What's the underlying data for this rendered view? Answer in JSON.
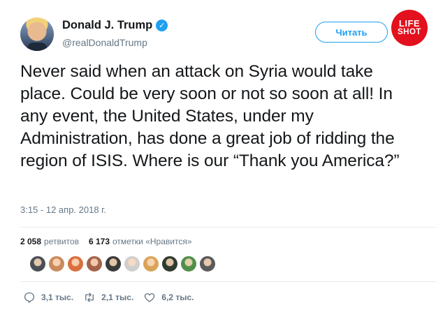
{
  "author": {
    "display_name": "Donald J. Trump",
    "handle": "@realDonaldTrump",
    "verified": true
  },
  "follow_button": {
    "label": "Читать"
  },
  "badge": {
    "line1": "LIFE",
    "line2": "SHOT",
    "color": "#e3101d"
  },
  "tweet": {
    "text": "Never said when an attack on Syria would take place. Could be very soon or not so soon at all! In any event, the United States, under my Administration, has done a great job of ridding the region of ISIS. Where is our “Thank you America?”",
    "timestamp": "3:15 - 12 апр. 2018 г."
  },
  "stats": {
    "retweets_count": "2 058",
    "retweets_label": "ретвитов",
    "likes_count": "6 173",
    "likes_label": "отметки «Нравится»"
  },
  "likers": {
    "colors": [
      "#4a4f57",
      "#c98b5e",
      "#d9703d",
      "#a5624a",
      "#3a3a3a",
      "#cfcfcf",
      "#d9a45a",
      "#2f3b2e",
      "#4f8f4a",
      "#5a5a5a"
    ]
  },
  "actions": {
    "replies": "3,1 тыс.",
    "retweets": "2,1 тыс.",
    "likes": "6,2 тыс."
  },
  "colors": {
    "accent": "#1da1f2",
    "muted": "#657786",
    "text": "#14171a"
  }
}
